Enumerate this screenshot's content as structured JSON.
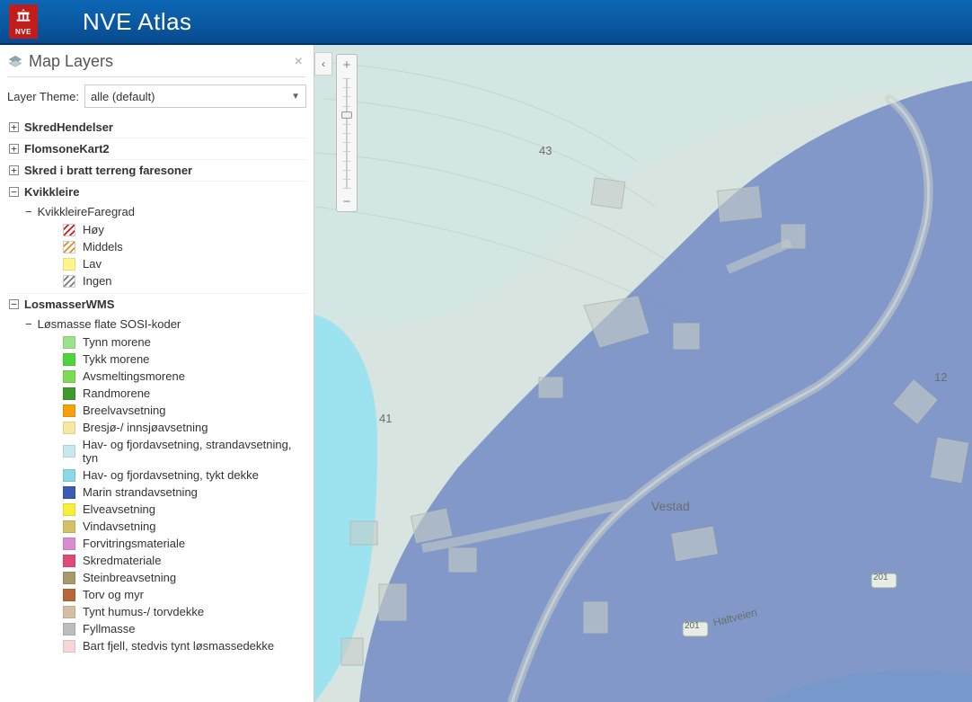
{
  "header": {
    "logo_text": "NVE",
    "app_title": "NVE Atlas"
  },
  "panel": {
    "title": "Map Layers",
    "theme_label": "Layer Theme:",
    "theme_value": "alle (default)"
  },
  "tree": [
    {
      "id": "skredhendelser",
      "label": "SkredHendelser",
      "expanded": false
    },
    {
      "id": "flomsonekart2",
      "label": "FlomsoneKart2",
      "expanded": false
    },
    {
      "id": "skred-bratt",
      "label": "Skred i bratt terreng faresoner",
      "expanded": false
    },
    {
      "id": "kvikkleire",
      "label": "Kvikkleire",
      "expanded": true,
      "children": [
        {
          "id": "kvikkleirefaregrad",
          "label": "KvikkleireFaregrad",
          "expanded": true,
          "legend": [
            {
              "label": "Høy",
              "type": "hatch",
              "stroke": "#d11313",
              "bg": "#ffffff"
            },
            {
              "label": "Middels",
              "type": "hatch",
              "stroke": "#e08a1a",
              "bg": "#ffffff"
            },
            {
              "label": "Lav",
              "type": "solid",
              "color": "#fff588"
            },
            {
              "label": "Ingen",
              "type": "hatch",
              "stroke": "#777777",
              "bg": "#ffffff"
            }
          ]
        }
      ]
    },
    {
      "id": "losmasserwms",
      "label": "LosmasserWMS",
      "expanded": true,
      "children": [
        {
          "id": "losmasse-sosi",
          "label": "Løsmasse flate SOSI-koder",
          "expanded": true,
          "legend": [
            {
              "label": "Tynn morene",
              "type": "solid",
              "color": "#9be28a"
            },
            {
              "label": "Tykk morene",
              "type": "solid",
              "color": "#4cd63a"
            },
            {
              "label": "Avsmeltingsmorene",
              "type": "solid",
              "color": "#7ed957"
            },
            {
              "label": "Randmorene",
              "type": "solid",
              "color": "#3f9a2e"
            },
            {
              "label": "Breelvavsetning",
              "type": "solid",
              "color": "#f5a10a"
            },
            {
              "label": "Bresjø-/ innsjøavsetning",
              "type": "solid",
              "color": "#f7e7a1"
            },
            {
              "label": "Hav- og fjordavsetning, strandavsetning, tyn",
              "type": "solid",
              "color": "#c9e8ee"
            },
            {
              "label": "Hav- og fjordavsetning, tykt dekke",
              "type": "solid",
              "color": "#8bd9e6"
            },
            {
              "label": "Marin strandavsetning",
              "type": "solid",
              "color": "#3b5cb5"
            },
            {
              "label": "Elveavsetning",
              "type": "solid",
              "color": "#f7f03a"
            },
            {
              "label": "Vindavsetning",
              "type": "solid",
              "color": "#d4c06a"
            },
            {
              "label": "Forvitringsmateriale",
              "type": "solid",
              "color": "#d98cd0"
            },
            {
              "label": "Skredmateriale",
              "type": "solid",
              "color": "#e04a7a"
            },
            {
              "label": "Steinbreavsetning",
              "type": "solid",
              "color": "#a79a6d"
            },
            {
              "label": "Torv og myr",
              "type": "solid",
              "color": "#b6683b"
            },
            {
              "label": "Tynt humus-/ torvdekke",
              "type": "solid",
              "color": "#d4bfa5"
            },
            {
              "label": "Fyllmasse",
              "type": "solid",
              "color": "#bdbdbd"
            },
            {
              "label": "Bart fjell, stedvis tynt løsmassedekke",
              "type": "solid",
              "color": "#f6d6d6"
            }
          ]
        }
      ]
    }
  ],
  "map": {
    "place_label": "Vestad",
    "house_numbers": [
      "43",
      "41",
      "12"
    ],
    "roads": [
      {
        "name": "Haltveien",
        "ref": "201"
      }
    ],
    "overlay_colors": {
      "land_base": "#d7e4e0",
      "thin_marine": "#c9e8ee",
      "thick_marine": "#9be2ed",
      "strand": "#6f87c2"
    },
    "zoom": {
      "levels": 13,
      "current_index": 4
    }
  }
}
